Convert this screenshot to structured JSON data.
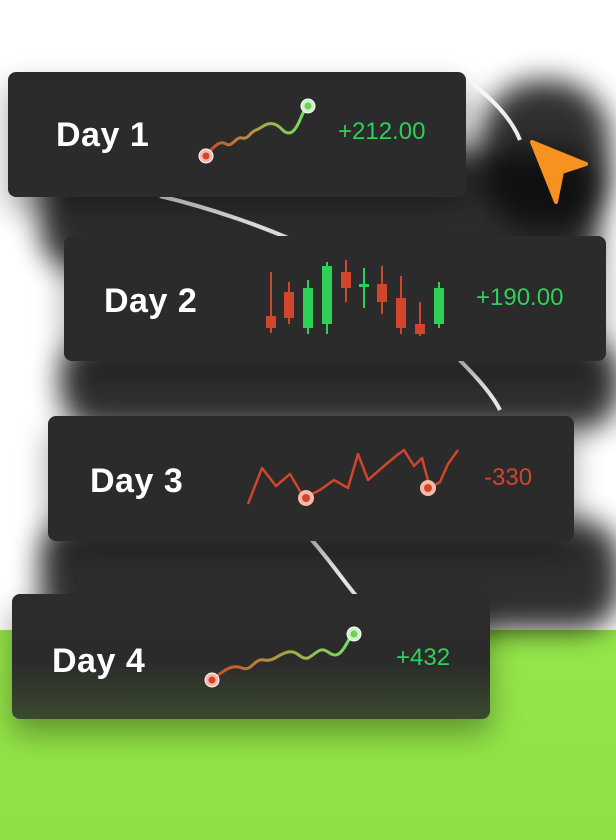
{
  "cards": [
    {
      "label": "Day 1",
      "value": "+212.00",
      "trend": "up",
      "chart": "line"
    },
    {
      "label": "Day 2",
      "value": "+190.00",
      "trend": "up",
      "chart": "candlestick"
    },
    {
      "label": "Day 3",
      "value": "-330",
      "trend": "down",
      "chart": "line"
    },
    {
      "label": "Day 4",
      "value": "+432",
      "trend": "up",
      "chart": "line"
    }
  ],
  "colors": {
    "card": "#2b2b2b",
    "positive": "#2ed158",
    "negative": "#d0452c",
    "accent_cursor": "#f7911f",
    "background_green": "#8ee045"
  },
  "icons": {
    "cursor": "pointer-arrow-icon"
  }
}
